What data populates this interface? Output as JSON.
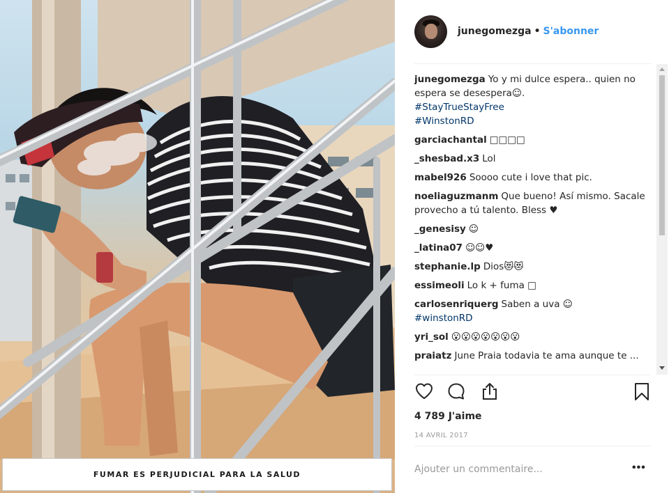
{
  "post": {
    "warning": "FUMAR ES PERJUDICIAL PARA LA SALUD"
  },
  "header": {
    "username": "junegomezga",
    "separator": "•",
    "follow_label": "S'abonner"
  },
  "comments": [
    {
      "author": "junegomezga",
      "text": "Yo y mi dulce espera.. quien no espera se desespera☺.",
      "tags": [
        "#StayTrueStayFree",
        "#WinstonRD"
      ]
    },
    {
      "author": "garciachantal",
      "text": "□□□□",
      "tags": []
    },
    {
      "author": "_shesbad.x3",
      "text": "Lol",
      "tags": []
    },
    {
      "author": "mabel926",
      "text": "Soooo cute i love that pic.",
      "tags": []
    },
    {
      "author": "noeliaguzmanm",
      "text": "Que bueno! Así mismo. Sacale provecho a tú talento. Bless ♥",
      "tags": []
    },
    {
      "author": "_genesisy",
      "text": "☺",
      "tags": []
    },
    {
      "author": "_latina07",
      "text": "☺☺♥",
      "tags": []
    },
    {
      "author": "stephanie.lp",
      "text": "Dios😻😻",
      "tags": []
    },
    {
      "author": "essimeoli",
      "text": "Lo k + fuma □",
      "tags": []
    },
    {
      "author": "carlosenriquerg",
      "text": "Saben a uva ☺",
      "tags": [
        "#winstonRD"
      ]
    },
    {
      "author": "yri_sol",
      "text": "😮😮😮😮😮😮😮",
      "tags": []
    },
    {
      "author": "praiatz",
      "text": "June Praia todavia te ama aunque te ...",
      "tags": []
    }
  ],
  "actions": {
    "like_icon": "heart-icon",
    "comment_icon": "comment-icon",
    "share_icon": "share-icon",
    "save_icon": "bookmark-icon"
  },
  "likes": "4 789 J'aime",
  "date": "14 AVRIL 2017",
  "comment_input": {
    "placeholder": "Ajouter un commentaire..."
  },
  "more_label": "•••",
  "colors": {
    "link": "#3897f0",
    "hashtag": "#003569",
    "text": "#262626",
    "muted": "#999999"
  }
}
